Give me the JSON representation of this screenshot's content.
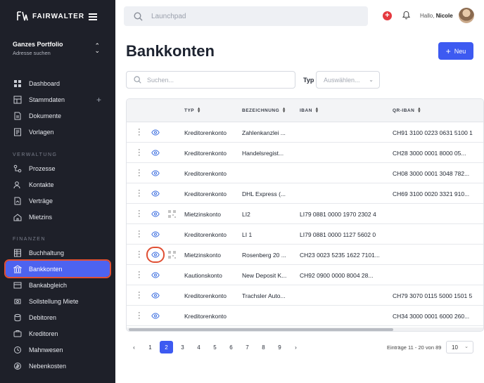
{
  "brand": {
    "name": "FAIRWALTER"
  },
  "portfolio": {
    "name": "Ganzes Portfolio",
    "sub": "Adresse suchen"
  },
  "sidebar": {
    "top_items": [
      {
        "label": "Dashboard",
        "icon": "dashboard-icon"
      },
      {
        "label": "Stammdaten",
        "icon": "database-icon"
      },
      {
        "label": "Dokumente",
        "icon": "document-icon"
      },
      {
        "label": "Vorlagen",
        "icon": "template-icon"
      }
    ],
    "section_verwaltung": "VERWALTUNG",
    "verwaltung_items": [
      {
        "label": "Prozesse",
        "icon": "process-icon"
      },
      {
        "label": "Kontakte",
        "icon": "contacts-icon"
      },
      {
        "label": "Verträge",
        "icon": "contract-icon"
      },
      {
        "label": "Mietzins",
        "icon": "rent-icon"
      }
    ],
    "section_finanzen": "FINANZEN",
    "finanzen_items": [
      {
        "label": "Buchhaltung",
        "icon": "ledger-icon"
      },
      {
        "label": "Bankkonten",
        "icon": "bank-icon",
        "active": true
      },
      {
        "label": "Bankabgleich",
        "icon": "bank-sync-icon"
      },
      {
        "label": "Sollstellung Miete",
        "icon": "invoice-icon"
      },
      {
        "label": "Debitoren",
        "icon": "debtor-icon"
      },
      {
        "label": "Kreditoren",
        "icon": "creditor-icon"
      },
      {
        "label": "Mahnwesen",
        "icon": "reminder-icon"
      },
      {
        "label": "Nebenkosten",
        "icon": "costs-icon"
      }
    ]
  },
  "topbar": {
    "search_placeholder": "Launchpad",
    "greeting": "Hallo,",
    "user": "Nicole"
  },
  "page": {
    "title": "Bankkonten",
    "new_button": "Neu",
    "search_placeholder": "Suchen...",
    "type_label": "Typ",
    "type_placeholder": "Auswählen..."
  },
  "table": {
    "headers": [
      "TYP",
      "BEZEICHNUNG",
      "IBAN",
      "QR-IBAN"
    ],
    "rows": [
      {
        "typ": "Kreditorenkonto",
        "bez": "Zahlenkanzlei ...",
        "iban": "",
        "qr": "CH91 3100 0223 0631 5100 1",
        "has_qr": false,
        "highlight": false
      },
      {
        "typ": "Kreditorenkonto",
        "bez": "Handelsregist...",
        "iban": "",
        "qr": "CH28 3000 0001 8000 05...",
        "has_qr": false,
        "highlight": false
      },
      {
        "typ": "Kreditorenkonto",
        "bez": "",
        "iban": "",
        "qr": "CH08 3000 0001 3048 782...",
        "has_qr": false,
        "highlight": false
      },
      {
        "typ": "Kreditorenkonto",
        "bez": "DHL Express (...",
        "iban": "",
        "qr": "CH69 3100 0020 3321 910...",
        "has_qr": false,
        "highlight": false
      },
      {
        "typ": "Mietzinskonto",
        "bez": "LI2",
        "iban": "LI79 0881 0000 1970 2302 4",
        "qr": "",
        "has_qr": true,
        "highlight": false
      },
      {
        "typ": "Kreditorenkonto",
        "bez": "LI 1",
        "iban": "LI79 0881 0000 1127 5602 0",
        "qr": "",
        "has_qr": false,
        "highlight": false
      },
      {
        "typ": "Mietzinskonto",
        "bez": "Rosenberg 20 ...",
        "iban": "CH23 0023 5235 1622 7101...",
        "qr": "",
        "has_qr": true,
        "highlight": true
      },
      {
        "typ": "Kautionskonto",
        "bez": "New Deposit K...",
        "iban": "CH92 0900 0000 8004 28...",
        "qr": "",
        "has_qr": false,
        "highlight": false
      },
      {
        "typ": "Kreditorenkonto",
        "bez": "Trachsler Auto...",
        "iban": "",
        "qr": "CH79 3070 0115 5000 1501 5",
        "has_qr": false,
        "highlight": false
      },
      {
        "typ": "Kreditorenkonto",
        "bez": "",
        "iban": "",
        "qr": "CH34 3000 0001 6000 260...",
        "has_qr": false,
        "highlight": false
      }
    ]
  },
  "pagination": {
    "pages": [
      "1",
      "2",
      "3",
      "4",
      "5",
      "6",
      "7",
      "8",
      "9"
    ],
    "current": "2",
    "prev": "‹",
    "next": "›",
    "summary": "Einträge 11 - 20 von 89",
    "per_page": "10"
  },
  "colors": {
    "sidebar": "#1e2029",
    "accent": "#3d5af1",
    "highlight": "#e04f33"
  }
}
